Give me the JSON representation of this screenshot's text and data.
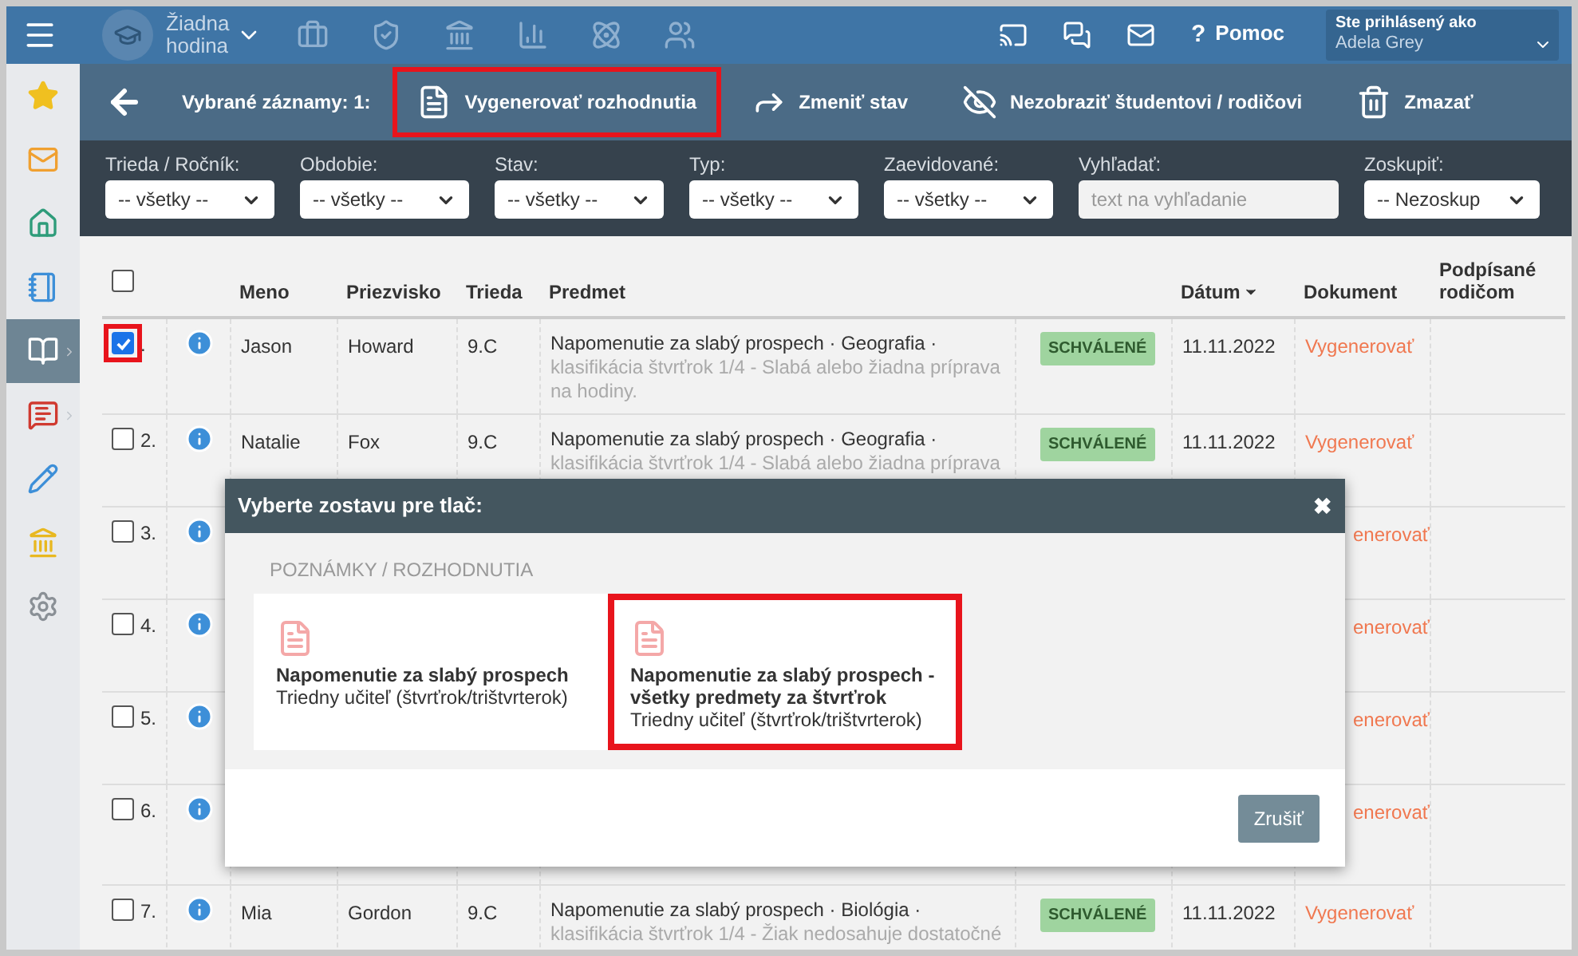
{
  "top_bar": {
    "lesson": "Žiadna hodina",
    "help_icon": "?",
    "help": "Pomoc",
    "user_caption": "Ste prihlásený ako",
    "user_name": "Adela Grey"
  },
  "sidebar": {
    "items": [
      {
        "selected": false,
        "arrow": false
      },
      {
        "selected": false,
        "arrow": false
      },
      {
        "selected": false,
        "arrow": false
      },
      {
        "selected": false,
        "arrow": false
      },
      {
        "selected": true,
        "arrow": true
      },
      {
        "selected": false,
        "arrow": true
      },
      {
        "selected": false,
        "arrow": false
      },
      {
        "selected": false,
        "arrow": false
      },
      {
        "selected": false,
        "arrow": false
      }
    ]
  },
  "action_bar": {
    "selection": "Vybrané záznamy: 1:",
    "actions": [
      {
        "kind": "pdf",
        "label": "Vygenerovať rozhodnutia",
        "highlighted": true
      },
      {
        "kind": "share",
        "label": "Zmeniť stav",
        "highlighted": false
      },
      {
        "kind": "hide",
        "label": "Nezobraziť študentovi / rodičovi",
        "highlighted": false
      },
      {
        "kind": "delete",
        "label": "Zmazať",
        "highlighted": false
      }
    ]
  },
  "filters": [
    {
      "kind": "select",
      "label": "Trieda / Ročník:",
      "value": "-- všetky --"
    },
    {
      "kind": "select",
      "label": "Obdobie:",
      "value": "-- všetky --"
    },
    {
      "kind": "select",
      "label": "Stav:",
      "value": "-- všetky --"
    },
    {
      "kind": "select",
      "label": "Typ:",
      "value": "-- všetky --"
    },
    {
      "kind": "select",
      "label": "Zaevidované:",
      "value": "-- všetky --"
    },
    {
      "kind": "search",
      "label": "Vyhľadať:",
      "placeholder": "text na vyhľadanie"
    },
    {
      "kind": "select",
      "label": "Zoskupiť:",
      "value": "-- Nezoskup"
    }
  ],
  "table": {
    "select_all": false,
    "columns": [
      "Meno",
      "Priezvisko",
      "Trieda",
      "Predmet",
      "Dátum",
      "Dokument",
      "Podpísané rodičom"
    ],
    "rows": [
      {
        "checked": true,
        "highlighted": true,
        "number": ".",
        "first_name": "Jason",
        "last_name": "Howard",
        "class": "9.C",
        "subject": "Napomenutie za slabý prospech · Geografia ·",
        "detail": "klasifikácia štvrťrok 1/4 - Slabá alebo žiadna príprava na hodiny.",
        "status": "SCHVÁLENÉ",
        "date": "11.11.2022",
        "document": "Vygenerovať"
      },
      {
        "checked": false,
        "highlighted": false,
        "number": "2.",
        "first_name": "Natalie",
        "last_name": "Fox",
        "class": "9.C",
        "subject": "Napomenutie za slabý prospech · Geografia ·",
        "detail": "klasifikácia štvrťrok 1/4 - Slabá alebo žiadna príprava",
        "status": "SCHVÁLENÉ",
        "date": "11.11.2022",
        "document": "Vygenerovať"
      },
      {
        "checked": false,
        "highlighted": false,
        "number": "3.",
        "document_tail": "enerovať"
      },
      {
        "checked": false,
        "highlighted": false,
        "number": "4.",
        "document_tail": "enerovať"
      },
      {
        "checked": false,
        "highlighted": false,
        "number": "5.",
        "document_tail": "enerovať"
      },
      {
        "checked": false,
        "highlighted": false,
        "number": "6.",
        "document_tail": "enerovať"
      },
      {
        "checked": false,
        "highlighted": false,
        "number": "7.",
        "first_name": "Mia",
        "last_name": "Gordon",
        "class": "9.C",
        "subject": "Napomenutie za slabý prospech · Biológia ·",
        "detail": "klasifikácia štvrťrok 1/4 - Žiak nedosahuje dostatočné",
        "status": "SCHVÁLENÉ",
        "date": "11.11.2022",
        "document": "Vygenerovať"
      }
    ]
  },
  "dialog": {
    "title": "Vyberte zostavu pre tlač:",
    "close": "✖",
    "section": "POZNÁMKY / ROZHODNUTIA",
    "options": [
      {
        "title": "Napomenutie za slabý prospech",
        "subtitle": "Triedny učiteľ (štvrťrok/trištvrterok)",
        "highlighted": false
      },
      {
        "title": "Napomenutie za slabý prospech - všetky predmety za štvrťrok",
        "subtitle": "Triedny učiteľ (štvrťrok/trištvrterok)",
        "highlighted": true
      }
    ],
    "cancel": "Zrušiť"
  }
}
